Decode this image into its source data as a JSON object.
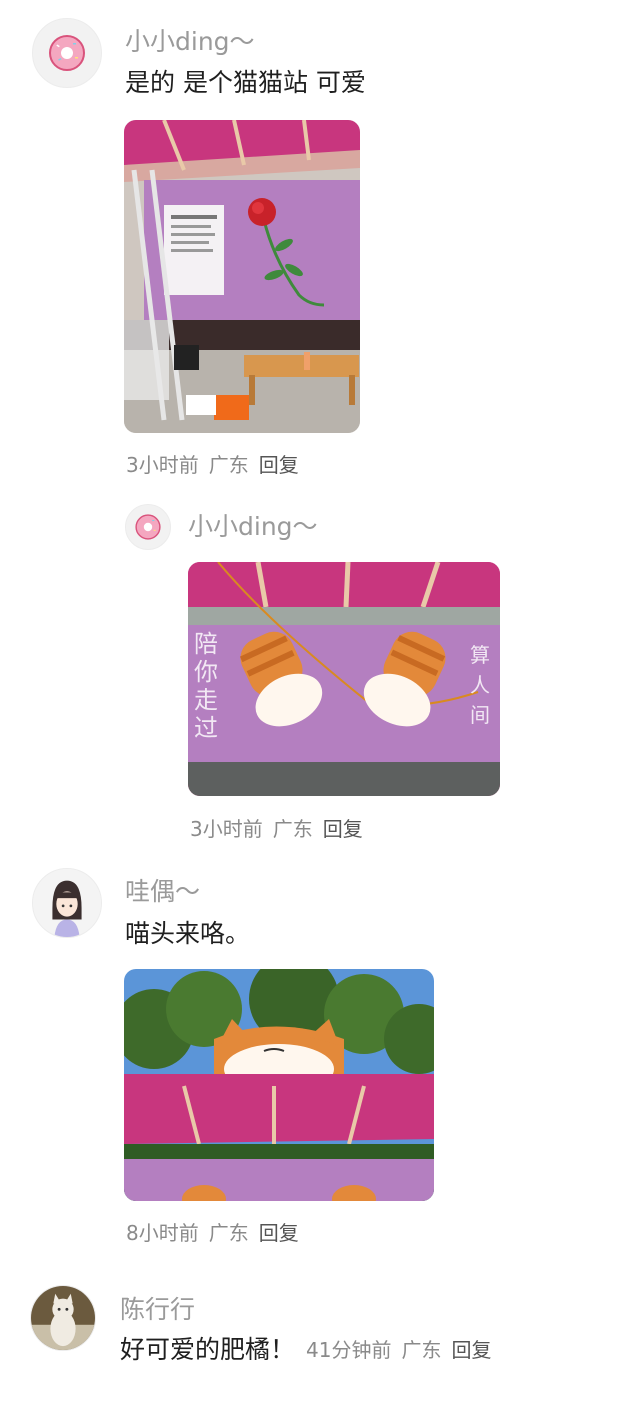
{
  "comments": [
    {
      "user": "小小ding～",
      "text": "是的 是个猫猫站 可爱",
      "time": "3小时前",
      "location": "广东",
      "reply_label": "回复",
      "avatar_icon": "donut-icon"
    },
    {
      "user": "小小ding～",
      "time": "3小时前",
      "location": "广东",
      "reply_label": "回复",
      "avatar_icon": "donut-icon"
    },
    {
      "user": "哇偶～",
      "text": "喵头来咯。",
      "time": "8小时前",
      "location": "广东",
      "reply_label": "回复",
      "avatar_icon": "cartoon-girl-icon"
    },
    {
      "user": "陈行行",
      "text": "好可爱的肥橘！",
      "time": "41分钟前",
      "location": "广东",
      "reply_label": "回复",
      "avatar_icon": "cat-photo-icon"
    }
  ],
  "colors": {
    "username": "#9a9a9a",
    "text": "#1f1f1f",
    "meta": "#8a8a8a",
    "canopy_pink": "#c8367e",
    "panel_purple": "#b47fc0",
    "cat_orange": "#e3893a"
  }
}
